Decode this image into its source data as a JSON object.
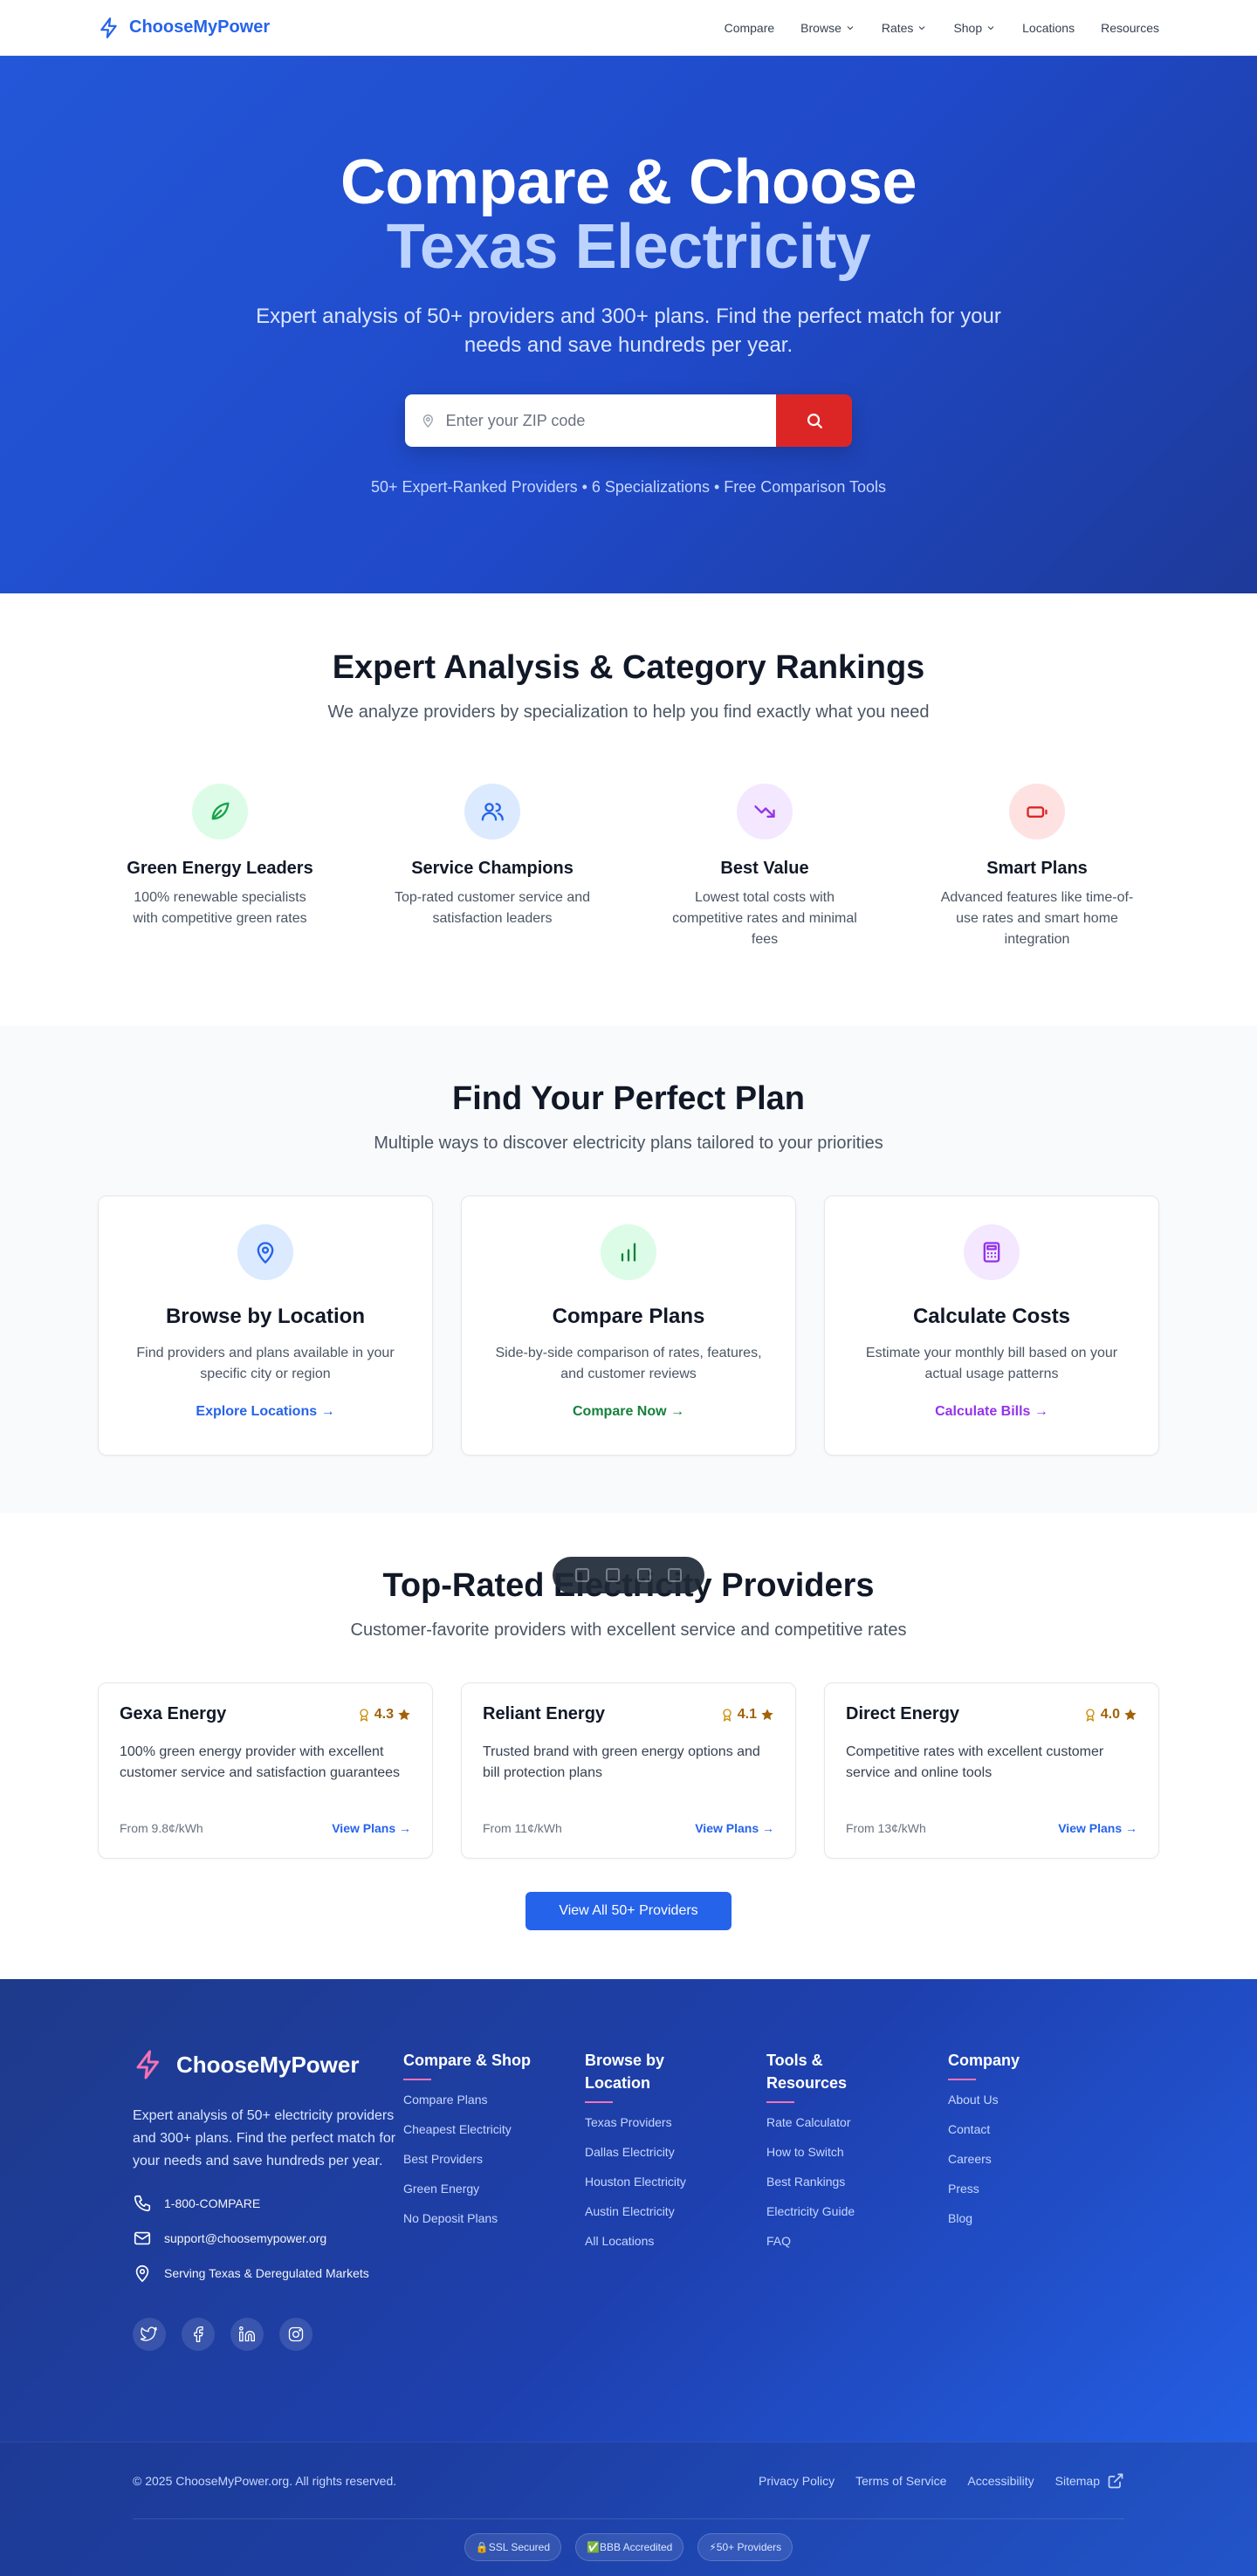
{
  "nav": {
    "brand": "ChooseMyPower",
    "links": [
      {
        "label": "Compare",
        "dropdown": false
      },
      {
        "label": "Browse",
        "dropdown": true
      },
      {
        "label": "Rates",
        "dropdown": true
      },
      {
        "label": "Shop",
        "dropdown": true
      },
      {
        "label": "Locations",
        "dropdown": false
      },
      {
        "label": "Resources",
        "dropdown": false
      }
    ]
  },
  "hero": {
    "title_line1": "Compare & Choose",
    "title_line2": "Texas Electricity",
    "subtitle": "Expert analysis of 50+ providers and 300+ plans. Find the perfect match for your needs and save hundreds per year.",
    "zip_placeholder": "Enter your ZIP code",
    "stats": "50+ Expert-Ranked Providers • 6 Specializations • Free Comparison Tools"
  },
  "expert": {
    "title": "Expert Analysis & Category Rankings",
    "subtitle": "We analyze providers by specialization to help you find exactly what you need",
    "categories": [
      {
        "title": "Green Energy Leaders",
        "desc": "100% renewable specialists with competitive green rates",
        "icon": "leaf-icon",
        "color": "#16a34a",
        "bg": "#dcfce7"
      },
      {
        "title": "Service Champions",
        "desc": "Top-rated customer service and satisfaction leaders",
        "icon": "users-icon",
        "color": "#2563eb",
        "bg": "#dbeafe"
      },
      {
        "title": "Best Value",
        "desc": "Lowest total costs with competitive rates and minimal fees",
        "icon": "trending-down-icon",
        "color": "#9333ea",
        "bg": "#f3e8ff"
      },
      {
        "title": "Smart Plans",
        "desc": "Advanced features like time-of-use rates and smart home integration",
        "icon": "battery-icon",
        "color": "#dc2626",
        "bg": "#fee2e2"
      }
    ]
  },
  "plans": {
    "title": "Find Your Perfect Plan",
    "subtitle": "Multiple ways to discover electricity plans tailored to your priorities",
    "cards": [
      {
        "title": "Browse by Location",
        "desc": "Find providers and plans available in your specific city or region",
        "link": "Explore Locations →",
        "icon": "map-pin-icon",
        "color": "#2563eb",
        "bg": "#dbeafe"
      },
      {
        "title": "Compare Plans",
        "desc": "Side-by-side comparison of rates, features, and customer reviews",
        "link": "Compare Now →",
        "icon": "bar-chart-icon",
        "color": "#15803d",
        "bg": "#dcfce7"
      },
      {
        "title": "Calculate Costs",
        "desc": "Estimate your monthly bill based on your actual usage patterns",
        "link": "Calculate Bills →",
        "icon": "calculator-icon",
        "color": "#9333ea",
        "bg": "#f3e8ff"
      }
    ]
  },
  "providers": {
    "title": "Top-Rated Electricity Providers",
    "subtitle": "Customer-favorite providers with excellent service and competitive rates",
    "items": [
      {
        "name": "Gexa Energy",
        "rating": "4.3",
        "desc": "100% green energy provider with excellent customer service and satisfaction guarantees",
        "price": "From 9.8¢/kWh",
        "link": "View Plans →"
      },
      {
        "name": "Reliant Energy",
        "rating": "4.1",
        "desc": "Trusted brand with green energy options and bill protection plans",
        "price": "From 11¢/kWh",
        "link": "View Plans →"
      },
      {
        "name": "Direct Energy",
        "rating": "4.0",
        "desc": "Competitive rates with excellent customer service and online tools",
        "price": "From 13¢/kWh",
        "link": "View Plans →"
      }
    ],
    "view_all": "View All 50+ Providers"
  },
  "footer": {
    "brand": "ChooseMyPower",
    "desc": "Expert analysis of 50+ electricity providers and 300+ plans. Find the perfect match for your needs and save hundreds per year.",
    "phone": "1-800-COMPARE",
    "email": "support@choosemypower.org",
    "region": "Serving Texas & Deregulated Markets",
    "columns": [
      {
        "title": "Compare & Shop",
        "links": [
          "Compare Plans",
          "Cheapest Electricity",
          "Best Providers",
          "Green Energy",
          "No Deposit Plans"
        ]
      },
      {
        "title": "Browse by Location",
        "links": [
          "Texas Providers",
          "Dallas Electricity",
          "Houston Electricity",
          "Austin Electricity",
          "All Locations"
        ]
      },
      {
        "title": "Tools & Resources",
        "links": [
          "Rate Calculator",
          "How to Switch",
          "Best Rankings",
          "Electricity Guide",
          "FAQ"
        ]
      },
      {
        "title": "Company",
        "links": [
          "About Us",
          "Contact",
          "Careers",
          "Press",
          "Blog"
        ]
      }
    ],
    "copyright": "© 2025 ChooseMyPower.org. All rights reserved.",
    "legal": [
      "Privacy Policy",
      "Terms of Service",
      "Accessibility",
      "Sitemap"
    ],
    "badges": [
      "🔒SSL Secured",
      "✅BBB Accredited",
      "⚡50+ Providers"
    ]
  }
}
